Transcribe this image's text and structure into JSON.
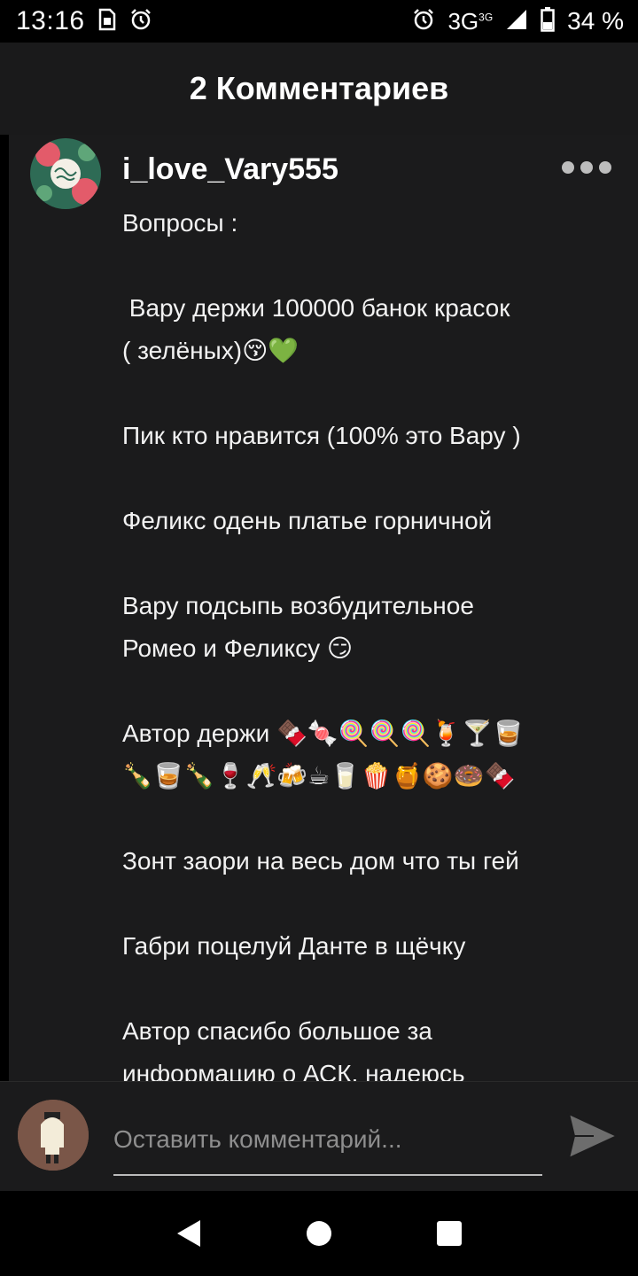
{
  "status_bar": {
    "time": "13:16",
    "left_icons": [
      "sim-card-icon",
      "alarm-clock-icon"
    ],
    "network": "3G",
    "network_sup": "3G",
    "battery": "34 %"
  },
  "header": {
    "title": "2 Комментариев"
  },
  "comment": {
    "username": "i_love_Vary555",
    "lines": [
      "Вопросы :",
      "",
      " Вару держи 100000 банок красок",
      "( зелёных)😚💚",
      "",
      "Пик кто нравится (100% это Вару )",
      "",
      "Феликс одень платье горничной",
      "",
      "Вару подсыпь возбудительное",
      "Ромео и Феликсу 😏",
      "",
      "Автор держи 🍫🍬🍭🍭🍭🍹🍸🥃",
      "🍾🥃🍾🍷🥂🍻☕🥛🍿🍯🍪🍩🍫",
      "",
      "Зонт заори на весь дом что ты гей",
      "",
      "Габри поцелуй Данте в щёчку",
      "",
      "Автор спасибо большое за",
      "информацию о АСК, надеюсь"
    ]
  },
  "composer": {
    "placeholder": "Оставить комментарий..."
  },
  "colors": {
    "background": "#000000",
    "panel": "#1b1b1c",
    "header": "#1a1a1b",
    "text": "#ffffff"
  }
}
